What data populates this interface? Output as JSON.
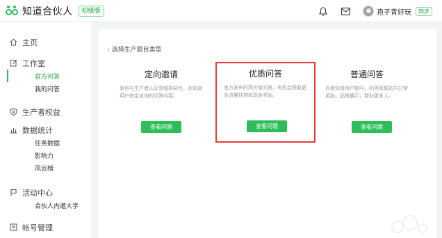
{
  "header": {
    "brand_name": "知道合伙人",
    "brand_badge": "初级版",
    "username": "孢子青好玩",
    "level_badge": "四步"
  },
  "sidebar": {
    "home": "主页",
    "workspace": "工作室",
    "workspace_items": [
      "官方问答",
      "我的问答"
    ],
    "rights": "生产者权益",
    "stats": "数据统计",
    "stats_items": [
      "任务数据",
      "影响力",
      "风云榜"
    ],
    "activity": "活动中心",
    "activity_items": [
      "合伙人内邀大学"
    ],
    "account": "帐号管理"
  },
  "main": {
    "breadcrumb": "选择生产题目类型",
    "options": [
      {
        "title": "定向邀请",
        "desc": "发布与生产者认证领域相契合，及知道用户指定咨询的问答内容。",
        "button": "查看问题"
      },
      {
        "title": "优质问答",
        "desc": "官方发布的高价值问答，有机会获取更多流量扶持和现金奖励。",
        "button": "查看问题"
      },
      {
        "title": "普通问答",
        "desc": "百度知道用户提问，回答获取站内日常奖励，品牌展示，帮助更多人。",
        "button": "查看问题"
      }
    ]
  },
  "colors": {
    "accent": "#2dbd5a",
    "highlight_border": "#e53b3b"
  }
}
